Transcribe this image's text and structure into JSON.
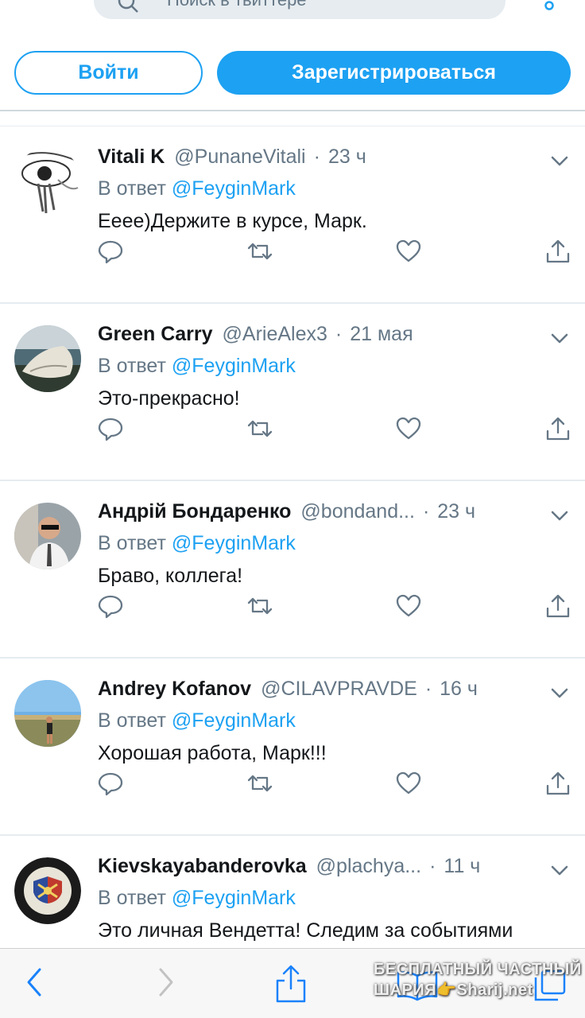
{
  "search": {
    "placeholder": "Поиск в твиттере"
  },
  "auth": {
    "login_label": "Войти",
    "signup_label": "Зарегистрироваться"
  },
  "colors": {
    "accent": "#1da1f2",
    "muted": "#657786",
    "text": "#14171a"
  },
  "tweets": [
    {
      "name": "Vitali K",
      "handle": "@PunaneVitali",
      "time": "23 ч",
      "reply_prefix": "В ответ",
      "reply_to": "@FeyginMark",
      "text": "Ееее)Держите в курсе, Марк."
    },
    {
      "name": "Green Carry",
      "handle": "@ArieAlex3",
      "time": "21 мая",
      "reply_prefix": "В ответ",
      "reply_to": "@FeyginMark",
      "text": "Это-прекрасно!"
    },
    {
      "name": "Андрій Бондаренко",
      "handle": "@bondand...",
      "time": "23 ч",
      "reply_prefix": "В ответ",
      "reply_to": "@FeyginMark",
      "text": "Браво, коллега!"
    },
    {
      "name": "Andrey Kofanov",
      "handle": "@CILAVPRAVDE",
      "time": "16 ч",
      "reply_prefix": "В ответ",
      "reply_to": "@FeyginMark",
      "text": "Хорошая работа, Марк!!!"
    },
    {
      "name": "Kievskayabanderovka",
      "handle": "@plachya...",
      "time": "11 ч",
      "reply_prefix": "В ответ",
      "reply_to": "@FeyginMark",
      "text": "Это личная Вендетта! Следим за событиями"
    }
  ],
  "watermark": {
    "line1": "БЕСПЛАТНЫЙ ЧАСТНЫЙ",
    "line2": "ШАРИЯ👉Sharij.net"
  }
}
